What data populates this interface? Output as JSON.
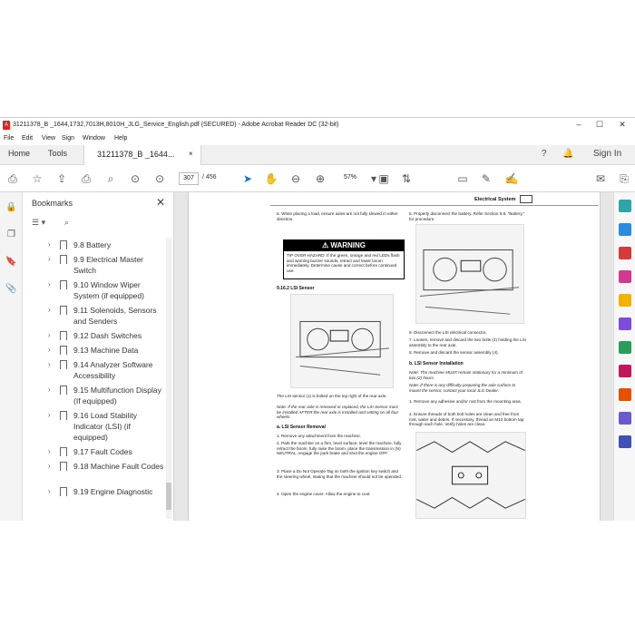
{
  "window": {
    "title": "31211378_B _1644,1732,7013H,8010H_JLG_Service_English.pdf (SECURED) - Adobe Acrobat Reader DC (32-bit)",
    "minimize": "–",
    "maximize": "☐",
    "close": "✕"
  },
  "menu": [
    "File",
    "Edit",
    "View",
    "Sign",
    "Window",
    "Help"
  ],
  "tabs": {
    "home": "Home",
    "tools": "Tools",
    "doc": "31211378_B _1644...",
    "doc_close": "×",
    "sign_in": "Sign In"
  },
  "toolbar": {
    "page_current": "307",
    "page_total": "/  456",
    "zoom": "57%"
  },
  "bookmarks": {
    "title": "Bookmarks",
    "close": "✕",
    "items": [
      {
        "label": "9.8 Battery",
        "lines": 1
      },
      {
        "label": "9.9 Electrical Master Switch",
        "lines": 2
      },
      {
        "label": "9.10 Window Wiper System (if equipped)",
        "lines": 2
      },
      {
        "label": "9.11 Solenoids, Sensors and Senders",
        "lines": 2
      },
      {
        "label": "9.12 Dash Switches",
        "lines": 1
      },
      {
        "label": "9.13 Machine Data",
        "lines": 1
      },
      {
        "label": "9.14 Analyzer Software Accessibility",
        "lines": 2
      },
      {
        "label": "9.15 Multifunction Display (If equipped)",
        "lines": 2
      },
      {
        "label": "9.16 Load Stability Indicator (LSI) (if equipped)",
        "lines": 3
      },
      {
        "label": "9.17 Fault Codes",
        "lines": 1
      },
      {
        "label": "9.18 Machine Fault Codes",
        "lines": 2
      },
      {
        "label": "9.19 Engine Diagnostic",
        "lines": 1
      }
    ]
  },
  "doc": {
    "section_header": "Electrical System",
    "step6": "6.  When placing a load, ensure axles are not fully slewed in either direction.",
    "warning_title": "WARNING",
    "warning_text": "TIP OVER HAZARD. If the green, orange and red LEDs flash and warning buzzer sounds, retract and lower boom immediately. Determine cause and correct before continued use.",
    "sec_916_2": "9.16.2    LSI Sensor",
    "lsi_sensor_note": "The LSI sensor (1) is bolted on the top right of the rear axle.",
    "lsi_note_italic": "Note: If the rear axle is removed or replaced, the LSI Sensor must be installed AFTER the rear axle is installed and setting on all four wheels.",
    "removal_title": "a.   LSI Sensor Removal",
    "removal_steps": [
      "1.  Remove any attachment from the machine.",
      "2.  Park the machine on a firm, level surface, level the machine, fully retract the boom, fully raise the boom, place the transmission in (N) NEUTRAL, engage the park brake and shut the engine OFF.",
      "3.  Place a Do Not Operate Tag on both the ignition key switch and the steering wheel, stating that the machine should not be operated.",
      "4.  Open the engine cover. Allow the engine to cool."
    ],
    "right_step5": "5.  Properly disconnect the battery. Refer Section 9.8, “Battery,” for procedure.",
    "right_steps": [
      "6.  Disconnect the LSI electrical connector.",
      "7.  Loosen, remove and discard the two bolts (4) holding the LSI assembly to the rear axle.",
      "8.  Remove and discard the sensor assembly (4)."
    ],
    "install_title": "b.   LSI Sensor Installation",
    "install_note1": "Note: The machine MUST remain stationary for a minimum of two (2) hours.",
    "install_note2": "Note: If there is any difficulty preparing the axle surface to mount the sensor, contact your local JLG Dealer.",
    "install_steps": [
      "1.  Remove any adhesive and/or rust from the mounting area.",
      "2.  Ensure threads of both bolt holes are clean and free from rust, water and debris. If necessary, thread an M10 bottom tap through each hole. Verify holes are clean."
    ]
  }
}
